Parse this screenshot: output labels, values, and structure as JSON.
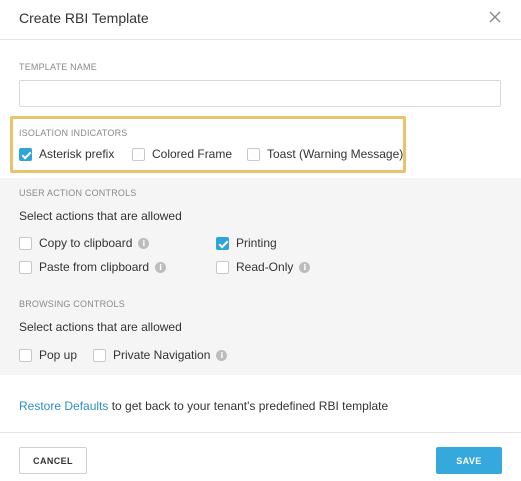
{
  "dialog": {
    "title": "Create RBI Template",
    "close_icon": "close-icon"
  },
  "template_name": {
    "label": "TEMPLATE NAME",
    "value": "",
    "placeholder": ""
  },
  "isolation_indicators": {
    "label": "ISOLATION INDICATORS",
    "highlight_color": "#e8c36b",
    "options": [
      {
        "label": "Asterisk prefix",
        "checked": true
      },
      {
        "label": "Colored Frame",
        "checked": false
      },
      {
        "label": "Toast (Warning Message)",
        "checked": false
      }
    ]
  },
  "user_action_controls": {
    "label": "USER ACTION CONTROLS",
    "description": "Select actions that are allowed",
    "options": [
      {
        "label": "Copy to clipboard",
        "checked": false,
        "info_icon": true
      },
      {
        "label": "Printing",
        "checked": true,
        "info_icon": false
      },
      {
        "label": "Paste from clipboard",
        "checked": false,
        "info_icon": true
      },
      {
        "label": "Read-Only",
        "checked": false,
        "info_icon": true
      }
    ]
  },
  "browsing_controls": {
    "label": "BROWSING CONTROLS",
    "description": "Select actions that are allowed",
    "options": [
      {
        "label": "Pop up",
        "checked": false,
        "info_icon": false
      },
      {
        "label": "Private Navigation",
        "checked": false,
        "info_icon": true
      }
    ]
  },
  "restore": {
    "link_text": "Restore Defaults",
    "rest_text": " to get back to your tenant's predefined RBI template"
  },
  "footer": {
    "cancel_label": "CANCEL",
    "save_label": "SAVE"
  },
  "colors": {
    "accent": "#2ea3dc",
    "save_button": "#35a8de",
    "link": "#2d8ec9",
    "gray_section": "#f5f5f5"
  }
}
